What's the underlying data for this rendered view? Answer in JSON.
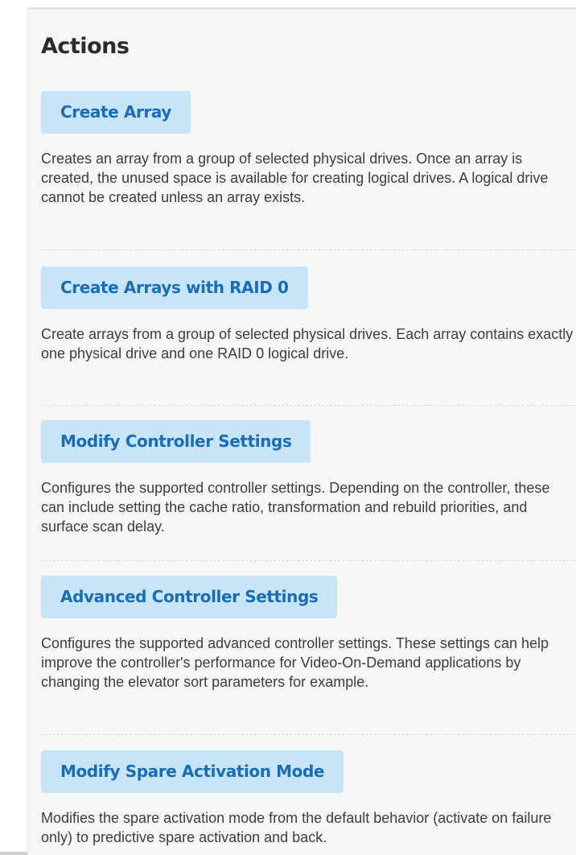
{
  "title": "Actions",
  "actions": [
    {
      "label": "Create Array",
      "description": "Creates an array from a group of selected physical drives. Once an array is created, the unused space is available for creating logical drives. A logical drive cannot be created unless an array exists."
    },
    {
      "label": "Create Arrays with RAID 0",
      "description": "Create arrays from a group of selected physical drives. Each array contains exactly one physical drive and one RAID 0 logical drive."
    },
    {
      "label": "Modify Controller Settings",
      "description": "Configures the supported controller settings. Depending on the controller, these can include setting the cache ratio, transformation and rebuild priorities, and surface scan delay."
    },
    {
      "label": "Advanced Controller Settings",
      "description": "Configures the supported advanced controller settings. These settings can help improve the controller's performance for Video-On-Demand applications by changing the elevator sort parameters for example."
    },
    {
      "label": "Modify Spare Activation Mode",
      "description": "Modifies the spare activation mode from the default behavior (activate on failure only) to predictive spare activation and back."
    }
  ]
}
